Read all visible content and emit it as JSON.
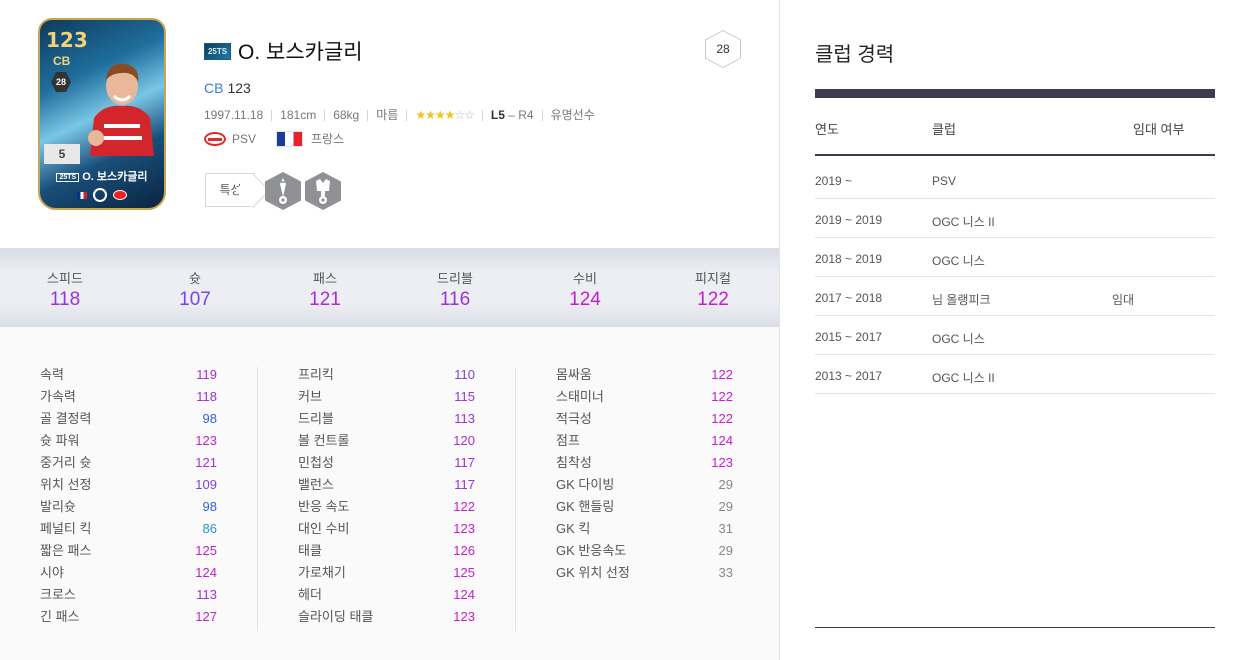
{
  "player": {
    "ovr": "123",
    "card_position": "CB",
    "card_level": "5",
    "card_badge": "28",
    "name": "O. 보스카글리",
    "season": "25TS",
    "position": "CB",
    "position_ovr": "123",
    "birth": "1997.11.18",
    "height": "181cm",
    "weight": "68kg",
    "build": "마름",
    "stars_on": "★★★★",
    "stars_off": "☆☆",
    "foot_left": "L5",
    "foot_right": " – R4",
    "tag": "유명선수",
    "club": "PSV",
    "nation": "프랑스",
    "trait_label": "특성",
    "hex_number": "28"
  },
  "summary": [
    {
      "label": "스피드",
      "value": "118",
      "color": "#9b30e0"
    },
    {
      "label": "슛",
      "value": "107",
      "color": "#7b43e4"
    },
    {
      "label": "패스",
      "value": "121",
      "color": "#b02ad8"
    },
    {
      "label": "드리블",
      "value": "116",
      "color": "#9b30e0"
    },
    {
      "label": "수비",
      "value": "124",
      "color": "#c71bd0"
    },
    {
      "label": "피지컬",
      "value": "122",
      "color": "#c71bd0"
    }
  ],
  "detail": [
    [
      {
        "name": "속력",
        "value": "119",
        "color": "#b02ad8"
      },
      {
        "name": "가속력",
        "value": "118",
        "color": "#9b30e0"
      },
      {
        "name": "골 결정력",
        "value": "98",
        "color": "#2f63d6"
      },
      {
        "name": "슛 파워",
        "value": "123",
        "color": "#c71bd0"
      },
      {
        "name": "중거리 슛",
        "value": "121",
        "color": "#b02ad8"
      },
      {
        "name": "위치 선정",
        "value": "109",
        "color": "#7b43e4"
      },
      {
        "name": "발리슛",
        "value": "98",
        "color": "#2f63d6"
      },
      {
        "name": "페널티 킥",
        "value": "86",
        "color": "#2f93d6"
      },
      {
        "name": "짧은 패스",
        "value": "125",
        "color": "#c71bd0"
      },
      {
        "name": "시야",
        "value": "124",
        "color": "#c71bd0"
      },
      {
        "name": "크로스",
        "value": "113",
        "color": "#9b30e0"
      },
      {
        "name": "긴 패스",
        "value": "127",
        "color": "#c71bd0"
      }
    ],
    [
      {
        "name": "프리킥",
        "value": "110",
        "color": "#7b43e4"
      },
      {
        "name": "커브",
        "value": "115",
        "color": "#9b30e0"
      },
      {
        "name": "드리블",
        "value": "113",
        "color": "#9b30e0"
      },
      {
        "name": "볼 컨트롤",
        "value": "120",
        "color": "#b02ad8"
      },
      {
        "name": "민첩성",
        "value": "117",
        "color": "#9b30e0"
      },
      {
        "name": "밸런스",
        "value": "117",
        "color": "#9b30e0"
      },
      {
        "name": "반응 속도",
        "value": "122",
        "color": "#c71bd0"
      },
      {
        "name": "대인 수비",
        "value": "123",
        "color": "#c71bd0"
      },
      {
        "name": "태클",
        "value": "126",
        "color": "#c71bd0"
      },
      {
        "name": "가로채기",
        "value": "125",
        "color": "#c71bd0"
      },
      {
        "name": "헤더",
        "value": "124",
        "color": "#c71bd0"
      },
      {
        "name": "슬라이딩 태클",
        "value": "123",
        "color": "#c71bd0"
      }
    ],
    [
      {
        "name": "몸싸움",
        "value": "122",
        "color": "#c71bd0"
      },
      {
        "name": "스태미너",
        "value": "122",
        "color": "#c71bd0"
      },
      {
        "name": "적극성",
        "value": "122",
        "color": "#c71bd0"
      },
      {
        "name": "점프",
        "value": "124",
        "color": "#c71bd0"
      },
      {
        "name": "침착성",
        "value": "123",
        "color": "#c71bd0"
      },
      {
        "name": "GK 다이빙",
        "value": "29",
        "color": "#888888"
      },
      {
        "name": "GK 핸들링",
        "value": "29",
        "color": "#888888"
      },
      {
        "name": "GK 킥",
        "value": "31",
        "color": "#888888"
      },
      {
        "name": "GK 반응속도",
        "value": "29",
        "color": "#888888"
      },
      {
        "name": "GK 위치 선정",
        "value": "33",
        "color": "#888888"
      }
    ]
  ],
  "career": {
    "title": "클럽 경력",
    "headers": [
      "연도",
      "클럽",
      "임대 여부"
    ],
    "rows": [
      {
        "years": "2019 ~",
        "club": "PSV",
        "loan": ""
      },
      {
        "years": "2019 ~ 2019",
        "club": "OGC 니스 II",
        "loan": ""
      },
      {
        "years": "2018 ~ 2019",
        "club": "OGC 니스",
        "loan": ""
      },
      {
        "years": "2017 ~ 2018",
        "club": "님 올랭피크",
        "loan": "임대"
      },
      {
        "years": "2015 ~ 2017",
        "club": "OGC 니스",
        "loan": ""
      },
      {
        "years": "2013 ~ 2017",
        "club": "OGC 니스 II",
        "loan": ""
      }
    ]
  }
}
